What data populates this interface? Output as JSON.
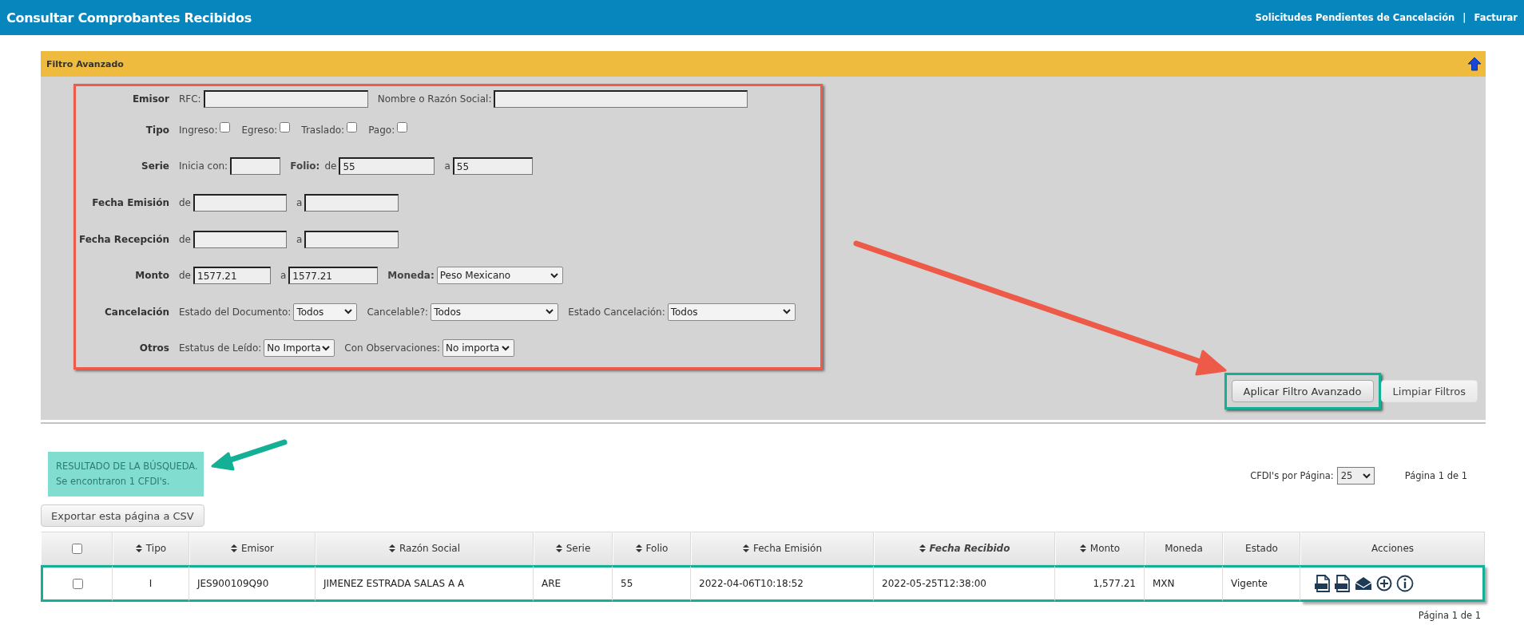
{
  "header": {
    "title": "Consultar Comprobantes Recibidos",
    "links": [
      {
        "label": "Solicitudes Pendientes de Cancelación"
      },
      {
        "label": "Facturar"
      }
    ],
    "separator": "|"
  },
  "filter": {
    "title": "Filtro Avanzado",
    "rows": [
      {
        "label": "Emisor",
        "items": [
          {
            "kind": "text",
            "text": "RFC:"
          },
          {
            "kind": "input"
          },
          {
            "kind": "text",
            "text": "Nombre o Razón Social:"
          },
          {
            "kind": "input"
          }
        ]
      },
      {
        "label": "Tipo",
        "items": [
          {
            "kind": "text",
            "text": "Ingreso:"
          },
          {
            "kind": "checkbox",
            "checked": false
          },
          {
            "kind": "text",
            "text": "Egreso:"
          },
          {
            "kind": "checkbox",
            "checked": false
          },
          {
            "kind": "text",
            "text": "Traslado:"
          },
          {
            "kind": "checkbox",
            "checked": false
          },
          {
            "kind": "text",
            "text": "Pago:"
          },
          {
            "kind": "checkbox",
            "checked": false
          }
        ]
      },
      {
        "label": "Serie",
        "items": [
          {
            "kind": "text",
            "text": "Inicia con:"
          },
          {
            "kind": "input"
          },
          {
            "kind": "text",
            "text": "Folio:",
            "strong": true
          },
          {
            "kind": "text",
            "text": "de"
          },
          {
            "kind": "input",
            "value": "55"
          },
          {
            "kind": "text",
            "text": "a"
          },
          {
            "kind": "input",
            "value": "55"
          }
        ]
      },
      {
        "label": "Fecha Emisión",
        "items": [
          {
            "kind": "text",
            "text": "de"
          },
          {
            "kind": "input"
          },
          {
            "kind": "text",
            "text": "a"
          },
          {
            "kind": "input"
          }
        ]
      },
      {
        "label": "Fecha Recepción",
        "items": [
          {
            "kind": "text",
            "text": "de"
          },
          {
            "kind": "input"
          },
          {
            "kind": "text",
            "text": "a"
          },
          {
            "kind": "input"
          }
        ]
      },
      {
        "label": "Monto",
        "items": [
          {
            "kind": "text",
            "text": "de"
          },
          {
            "kind": "input",
            "value": "1577.21"
          },
          {
            "kind": "text",
            "text": "a"
          },
          {
            "kind": "input",
            "value": "1577.21"
          },
          {
            "kind": "text",
            "text": "Moneda:",
            "strong": true
          },
          {
            "kind": "select",
            "value": "Peso Mexicano"
          }
        ]
      },
      {
        "label": "Cancelación",
        "items": [
          {
            "kind": "text",
            "text": "Estado del Documento:"
          },
          {
            "kind": "select",
            "value": "Todos"
          },
          {
            "kind": "text",
            "text": "Cancelable?:"
          },
          {
            "kind": "select",
            "value": "Todos"
          },
          {
            "kind": "text",
            "text": "Estado Cancelación:"
          },
          {
            "kind": "select",
            "value": "Todos"
          }
        ]
      },
      {
        "label": "Otros",
        "items": [
          {
            "kind": "text",
            "text": "Estatus de Leído:"
          },
          {
            "kind": "select",
            "value": "No Importa"
          },
          {
            "kind": "text",
            "text": "Con Observaciones:"
          },
          {
            "kind": "select",
            "value": "No importa"
          }
        ]
      }
    ],
    "buttons": [
      {
        "label": "Aplicar Filtro Avanzado",
        "highlighted": true
      },
      {
        "label": "Limpiar Filtros",
        "highlighted": false
      }
    ]
  },
  "results": {
    "message": [
      "RESULTADO DE LA BÚSQUEDA.",
      "Se encontraron 1 CFDI's."
    ],
    "export_button": "Exportar esta página a CSV",
    "per_page": {
      "label": "CFDI's por Página:",
      "value": "25"
    },
    "page_top": "Página 1 de 1"
  },
  "table": {
    "select_all": {
      "checked": false
    },
    "columns": [
      {
        "label": "Tipo",
        "sortable": true,
        "sorted": false
      },
      {
        "label": "Emisor",
        "sortable": true,
        "sorted": false
      },
      {
        "label": "Razón Social",
        "sortable": true,
        "sorted": false
      },
      {
        "label": "Serie",
        "sortable": true,
        "sorted": false
      },
      {
        "label": "Folio",
        "sortable": true,
        "sorted": false
      },
      {
        "label": "Fecha Emisión",
        "sortable": true,
        "sorted": false
      },
      {
        "label": "Fecha Recibido",
        "sortable": true,
        "sorted": true
      },
      {
        "label": "Monto",
        "sortable": true,
        "sorted": false
      },
      {
        "label": "Moneda",
        "sortable": false,
        "sorted": false
      },
      {
        "label": "Estado",
        "sortable": false,
        "sorted": false
      },
      {
        "label": "Acciones",
        "sortable": false,
        "sorted": false
      }
    ],
    "rows": [
      {
        "checked": false,
        "highlighted": true,
        "cells": [
          "I",
          "JES900109Q90",
          "JIMENEZ ESTRADA SALAS A A",
          "ARE",
          "55",
          "2022-04-06T10:18:52",
          "2022-05-25T12:38:00",
          "1,577.21",
          "MXN",
          "Vigente"
        ]
      }
    ]
  },
  "page_bottom": "Página 1 de 1"
}
